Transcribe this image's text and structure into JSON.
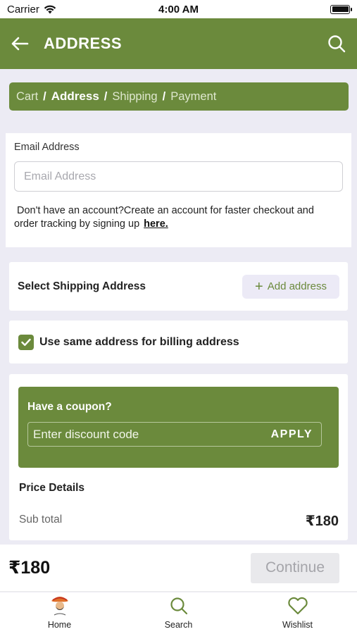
{
  "status_bar": {
    "carrier": "Carrier",
    "time": "4:00 AM"
  },
  "app_bar": {
    "title": "ADDRESS"
  },
  "breadcrumb": {
    "steps": [
      "Cart",
      "Address",
      "Shipping",
      "Payment"
    ],
    "separator": "/",
    "active": "Address"
  },
  "email_section": {
    "label": "Email Address",
    "placeholder": "Email Address",
    "value": "",
    "note_line1": "Don't have an account?Create an account for faster checkout and",
    "note_line2": "order tracking by signing up",
    "link_label": "here."
  },
  "shipping": {
    "title": "Select Shipping Address",
    "add_button_label": "Add address"
  },
  "billing": {
    "label": "Use same address for billing address",
    "checked": true
  },
  "coupon": {
    "title": "Have a coupon?",
    "placeholder": "Enter discount code",
    "apply_label": "APPLY"
  },
  "price_details": {
    "heading": "Price Details",
    "subtotal_label": "Sub total",
    "subtotal_value": "₹180"
  },
  "footer": {
    "total": "₹180",
    "continue_label": "Continue"
  },
  "tabs": [
    {
      "label": "Home",
      "icon": "home-logo"
    },
    {
      "label": "Search",
      "icon": "search-icon"
    },
    {
      "label": "Wishlist",
      "icon": "heart-icon"
    }
  ],
  "colors": {
    "brand_green": "#6b8a3c",
    "background": "#ecebf4",
    "disabled_button": "#e9e9ec"
  }
}
